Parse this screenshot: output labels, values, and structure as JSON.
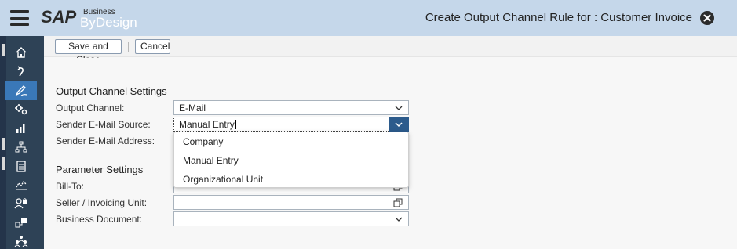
{
  "shell": {
    "title": "Create Output Channel Rule for : Customer Invoice",
    "logo_main": "SAP",
    "logo_super": "Business",
    "logo_sub": "ByDesign"
  },
  "toolbar": {
    "save_close_label": "Save and Close",
    "cancel_label": "Cancel"
  },
  "output_channel_settings": {
    "title": "Output Channel Settings",
    "output_channel_label": "Output Channel:",
    "output_channel_value": "E-Mail",
    "sender_source_label": "Sender E-Mail Source:",
    "sender_source_value": "Manual Entry",
    "sender_address_label": "Sender E-Mail Address:"
  },
  "parameter_settings": {
    "title": "Parameter Settings",
    "bill_to_label": "Bill-To:",
    "seller_label": "Seller / Invoicing Unit:",
    "business_document_label": "Business Document:"
  },
  "dropdown": {
    "options": [
      "Company",
      "Manual Entry",
      "Organizational Unit"
    ]
  },
  "nav": {
    "icons": [
      "home-icon",
      "refresh-icon",
      "edit-icon",
      "settings-icon",
      "analytics-icon",
      "hierarchy-icon",
      "clipboard-icon",
      "chart-icon",
      "user-lock-icon",
      "org-icon",
      "team-icon"
    ],
    "active_index": 2
  },
  "colors": {
    "shellbar": "#c5d7ea",
    "nav_bg": "#2e4256",
    "nav_active": "#3a78b8",
    "dropdown_button": "#2c5b8c"
  }
}
